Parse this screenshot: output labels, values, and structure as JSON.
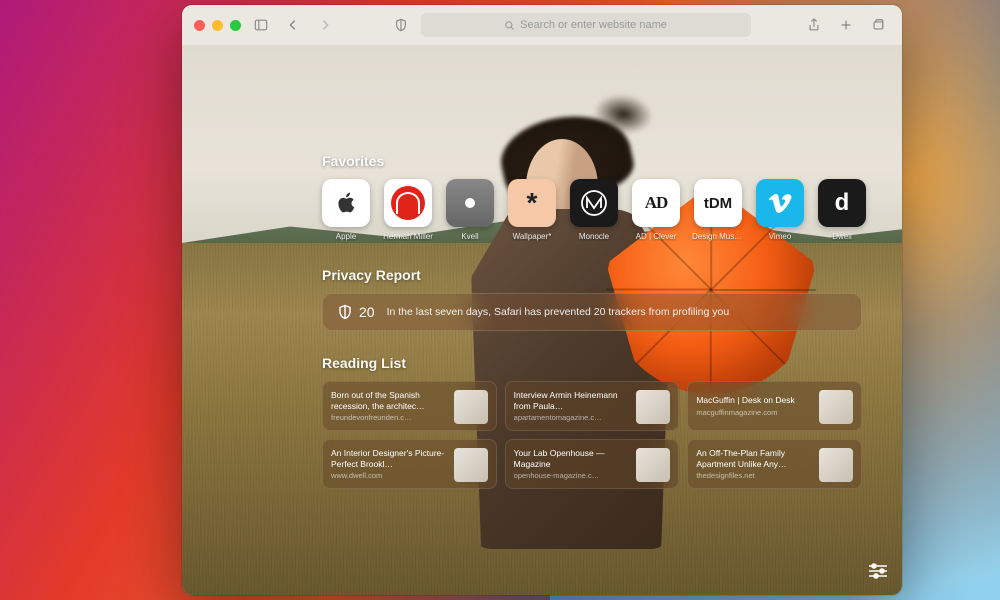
{
  "toolbar": {
    "search_placeholder": "Search or enter website name"
  },
  "sections": {
    "favorites_title": "Favorites",
    "privacy_title": "Privacy Report",
    "reading_title": "Reading List"
  },
  "favorites": [
    {
      "label": "Apple",
      "icon": "apple"
    },
    {
      "label": "Herman Miller",
      "icon": "hm"
    },
    {
      "label": "Kvell",
      "icon": "kvell"
    },
    {
      "label": "Wallpaper*",
      "icon": "wallpaper"
    },
    {
      "label": "Monocle",
      "icon": "monocle"
    },
    {
      "label": "AD | Clever",
      "icon": "ad"
    },
    {
      "label": "Design Museum",
      "icon": "tdm"
    },
    {
      "label": "Vimeo",
      "icon": "vimeo"
    },
    {
      "label": "Dwell",
      "icon": "dwell"
    }
  ],
  "privacy": {
    "count": "20",
    "message": "In the last seven days, Safari has prevented 20 trackers from profiling you"
  },
  "reading_list": [
    {
      "title": "Born out of the Spanish recession, the architec…",
      "source": "freundevonfreunden.c…"
    },
    {
      "title": "Interview Armin Heinemann from Paula…",
      "source": "apartamentomagazine.c…"
    },
    {
      "title": "MacGuffin | Desk on Desk",
      "source": "macguffinmagazine.com"
    },
    {
      "title": "An Interior Designer's Picture-Perfect Brookl…",
      "source": "www.dwell.com"
    },
    {
      "title": "Your Lab Openhouse — Magazine",
      "source": "openhouse-magazine.c…"
    },
    {
      "title": "An Off-The-Plan Family Apartment Unlike Any…",
      "source": "thedesignfiles.net"
    }
  ]
}
